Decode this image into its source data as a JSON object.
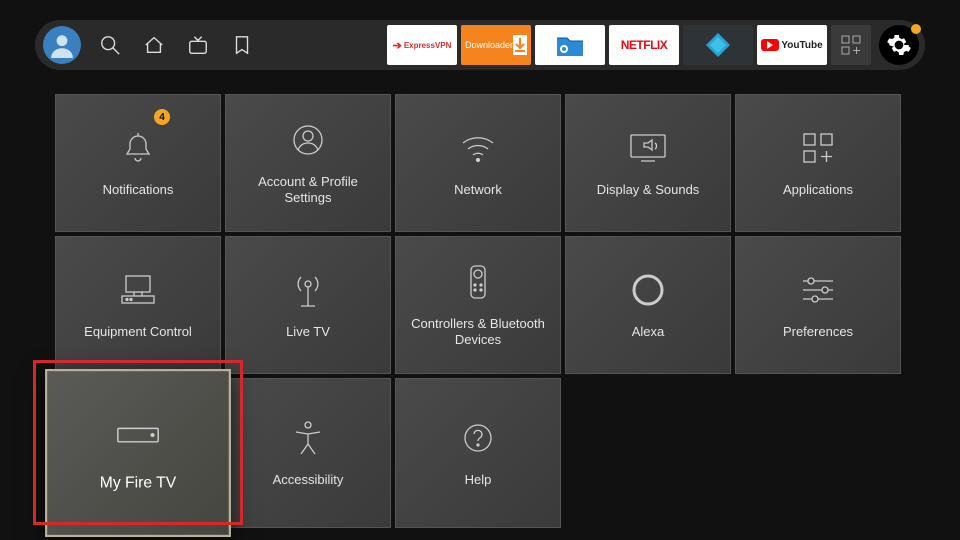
{
  "topbar": {
    "nav": [
      "search",
      "home",
      "live",
      "bookmark"
    ],
    "apps": [
      {
        "id": "expressvpn",
        "label": "ExpressVPN"
      },
      {
        "id": "downloader",
        "label": "Downloader"
      },
      {
        "id": "esfile",
        "label": "ES"
      },
      {
        "id": "netflix",
        "label": "NETFLIX"
      },
      {
        "id": "kodi",
        "label": "Kodi"
      },
      {
        "id": "youtube",
        "label": "YouTube"
      }
    ]
  },
  "settings": {
    "tiles": [
      {
        "id": "notifications",
        "label": "Notifications",
        "badge": "4"
      },
      {
        "id": "account",
        "label": "Account & Profile Settings"
      },
      {
        "id": "network",
        "label": "Network"
      },
      {
        "id": "display",
        "label": "Display & Sounds"
      },
      {
        "id": "applications",
        "label": "Applications"
      },
      {
        "id": "equipment",
        "label": "Equipment Control"
      },
      {
        "id": "livetv",
        "label": "Live TV"
      },
      {
        "id": "controllers",
        "label": "Controllers & Bluetooth Devices"
      },
      {
        "id": "alexa",
        "label": "Alexa"
      },
      {
        "id": "preferences",
        "label": "Preferences"
      },
      {
        "id": "myfiretv",
        "label": "My Fire TV",
        "selected": true
      },
      {
        "id": "accessibility",
        "label": "Accessibility"
      },
      {
        "id": "help",
        "label": "Help"
      }
    ]
  }
}
